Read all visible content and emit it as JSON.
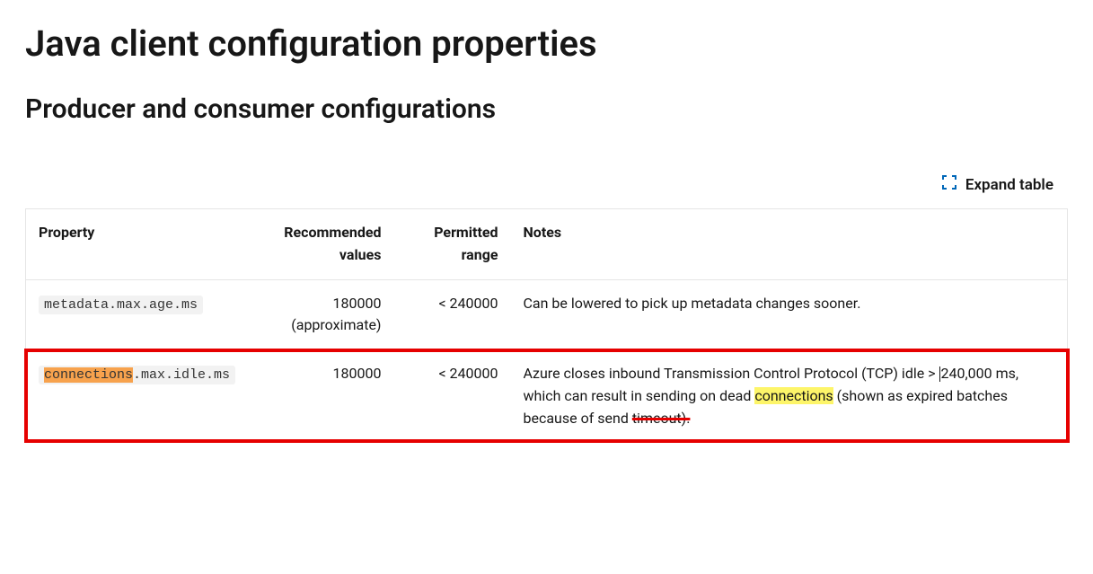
{
  "title": "Java client configuration properties",
  "section_title": "Producer and consumer configurations",
  "actions": {
    "expand_label": "Expand table"
  },
  "table": {
    "headers": {
      "property": "Property",
      "recommended": "Recommended values",
      "permitted": "Permitted range",
      "notes": "Notes"
    },
    "rows": [
      {
        "property_code": "metadata.max.age.ms",
        "recommended": "180000 (approximate)",
        "permitted": "< 240000",
        "notes": "Can be lowered to pick up metadata changes sooner."
      },
      {
        "property_prefix_hl": "connections",
        "property_suffix": ".max.idle.ms",
        "recommended": "180000",
        "permitted": "< 240000",
        "notes_pre": "Azure closes inbound Transmission Control Protocol (TCP) idle > ",
        "notes_caret_after": "240,000 ms, which can result in sending on dead ",
        "notes_hl": "connections",
        "notes_post": " (shown as expired batches because of send ",
        "notes_struck": "timeout)."
      }
    ]
  }
}
